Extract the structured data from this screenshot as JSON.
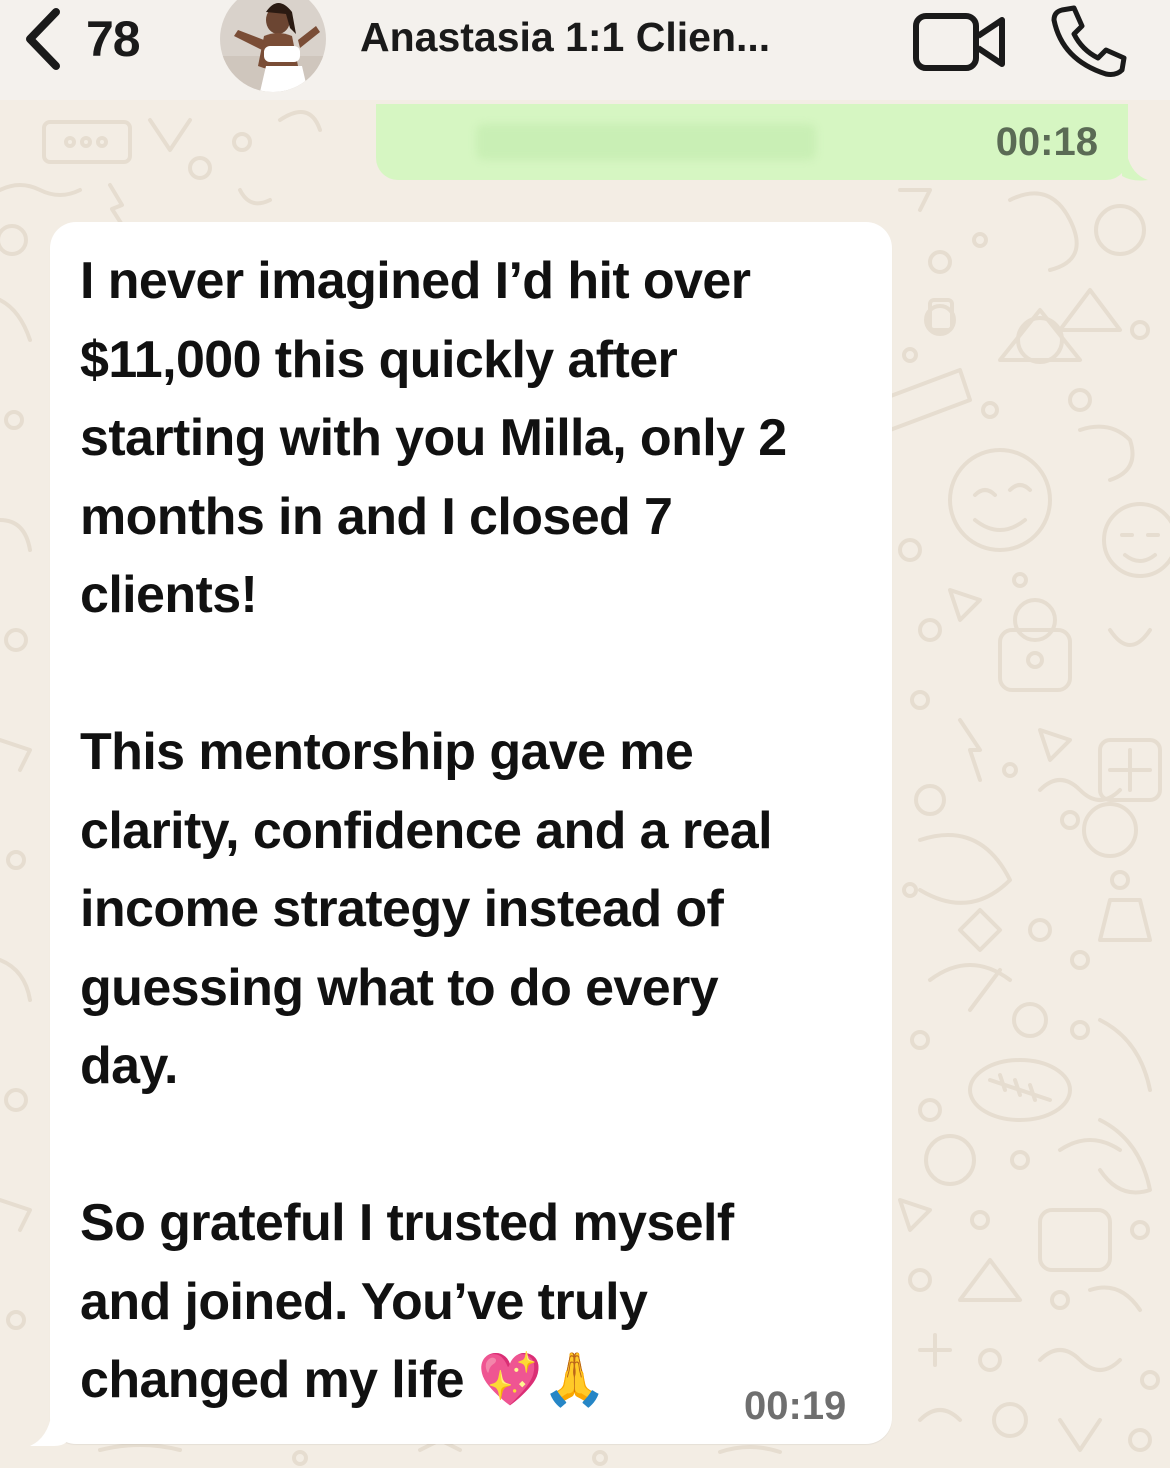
{
  "header": {
    "back_count": "78",
    "title": "Anastasia 1:1 Clien...",
    "icons": {
      "back": "chevron-left-icon",
      "video": "video-camera-icon",
      "call": "phone-icon"
    }
  },
  "messages": [
    {
      "direction": "outgoing",
      "text": "",
      "time": "00:18"
    },
    {
      "direction": "incoming",
      "paragraphs": [
        {
          "lines": [
            "I never imagined I’d hit over",
            "$11,000 this quickly after",
            "starting with you Milla, only 2",
            "months in and I closed 7",
            "clients!"
          ]
        },
        {
          "lines": [
            "This mentorship gave me",
            "clarity, confidence and a real",
            "income strategy instead of",
            "guessing what to do every",
            "day."
          ]
        },
        {
          "lines": [
            "So grateful I trusted myself",
            "and joined. You’ve truly",
            "changed my life 💖🙏"
          ]
        }
      ],
      "time": "00:19"
    }
  ],
  "colors": {
    "background": "#f3ede4",
    "header": "#f4f1ed",
    "outgoing_bubble": "#d6f6c2",
    "incoming_bubble": "#ffffff",
    "doodle": "#e6ddd0"
  }
}
